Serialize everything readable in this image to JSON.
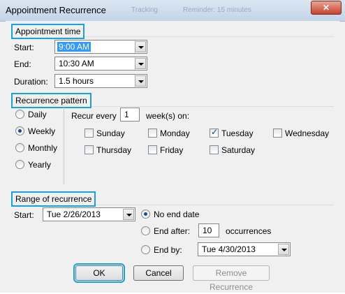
{
  "window": {
    "title": "Appointment Recurrence",
    "close_label": "✕",
    "ghost_texts": [
      "Tracking",
      "Reminder: 15 minutes"
    ]
  },
  "appointment_time": {
    "heading": "Appointment time",
    "start_label": "Start:",
    "start_value": "9:00 AM",
    "end_label": "End:",
    "end_value": "10:30 AM",
    "duration_label": "Duration:",
    "duration_value": "1.5 hours"
  },
  "recurrence_pattern": {
    "heading": "Recurrence pattern",
    "options": [
      {
        "label": "Daily",
        "selected": false
      },
      {
        "label": "Weekly",
        "selected": true
      },
      {
        "label": "Monthly",
        "selected": false
      },
      {
        "label": "Yearly",
        "selected": false
      }
    ],
    "recur_every_label": "Recur every",
    "recur_every_value": "1",
    "weeks_on_label": "week(s) on:",
    "days": [
      {
        "label": "Sunday",
        "checked": false
      },
      {
        "label": "Monday",
        "checked": false
      },
      {
        "label": "Tuesday",
        "checked": true
      },
      {
        "label": "Wednesday",
        "checked": false
      },
      {
        "label": "Thursday",
        "checked": false
      },
      {
        "label": "Friday",
        "checked": false
      },
      {
        "label": "Saturday",
        "checked": false
      }
    ]
  },
  "range": {
    "heading": "Range of recurrence",
    "start_label": "Start:",
    "start_value": "Tue 2/26/2013",
    "no_end_label": "No end date",
    "end_after_label": "End after:",
    "end_after_value": "10",
    "occurrences_label": "occurrences",
    "end_by_label": "End by:",
    "end_by_value": "Tue 4/30/2013",
    "selected": "no_end"
  },
  "buttons": {
    "ok": "OK",
    "cancel": "Cancel",
    "remove": "Remove Recurrence"
  }
}
